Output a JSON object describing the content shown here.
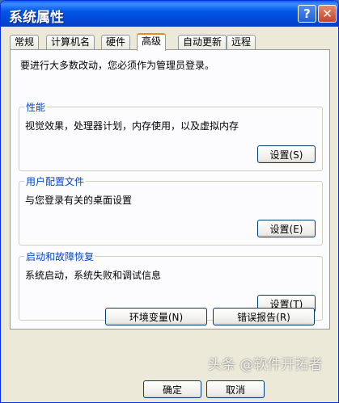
{
  "window": {
    "title": "系统属性"
  },
  "titlebar": {
    "help_glyph": "?",
    "close_glyph": "✕"
  },
  "tabs": [
    {
      "label": "常规"
    },
    {
      "label": "计算机名"
    },
    {
      "label": "硬件"
    },
    {
      "label": "高级",
      "active": true
    },
    {
      "label": "自动更新"
    },
    {
      "label": "远程"
    }
  ],
  "panel": {
    "notice": "要进行大多数改动，您必须作为管理员登录。",
    "performance": {
      "title": "性能",
      "desc": "视觉效果，处理器计划，内存使用，以及虚拟内存",
      "button": "设置(S)"
    },
    "user_profiles": {
      "title": "用户配置文件",
      "desc": "与您登录有关的桌面设置",
      "button": "设置(E)"
    },
    "startup_recovery": {
      "title": "启动和故障恢复",
      "desc": "系统启动，系统失败和调试信息",
      "button": "设置(T)"
    }
  },
  "env_button": "环境变量(N)",
  "error_report_button": "错误报告(R)",
  "footer": {
    "ok": "确定",
    "cancel": "取消"
  },
  "watermark": "头条 @软件开拓者",
  "colors": {
    "titlebar": "#0054e3",
    "group_title": "#0046d5",
    "active_tab": "#e68b2c"
  }
}
